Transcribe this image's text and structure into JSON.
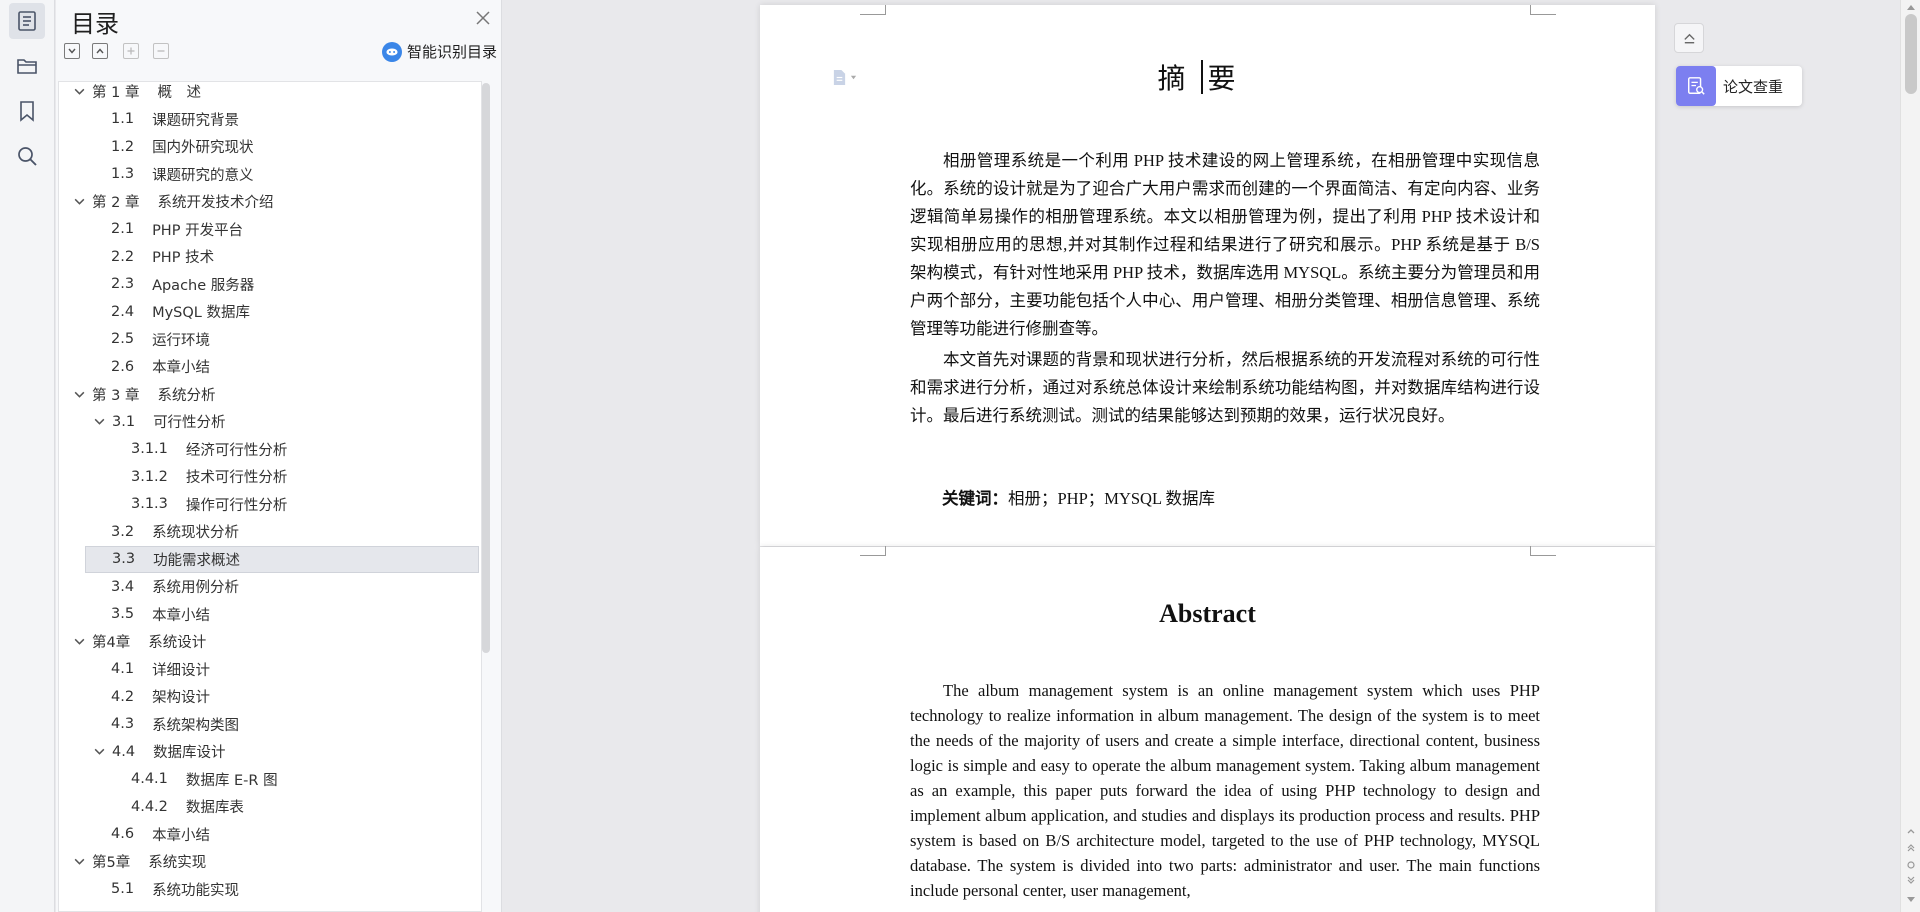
{
  "rail": {
    "items": [
      {
        "name": "outline-icon"
      },
      {
        "name": "folder-icon"
      },
      {
        "name": "bookmark-icon"
      },
      {
        "name": "search-icon"
      }
    ]
  },
  "toc": {
    "title": "目录",
    "smart_label": "智能识别目录",
    "items": [
      {
        "num": "第 1 章",
        "text": "概　述",
        "level": 0,
        "caret": true
      },
      {
        "num": "1.1",
        "text": "课题研究背景",
        "level": 1
      },
      {
        "num": "1.2",
        "text": "国内外研究现状",
        "level": 1
      },
      {
        "num": "1.3",
        "text": "课题研究的意义",
        "level": 1
      },
      {
        "num": "第 2 章",
        "text": "系统开发技术介绍",
        "level": 0,
        "caret": true
      },
      {
        "num": "2.1",
        "text": "PHP 开发平台",
        "level": 1
      },
      {
        "num": "2.2",
        "text": "PHP 技术",
        "level": 1
      },
      {
        "num": "2.3",
        "text": "Apache 服务器",
        "level": 1
      },
      {
        "num": "2.4",
        "text": "MySQL 数据库",
        "level": 1
      },
      {
        "num": "2.5",
        "text": "运行环境",
        "level": 1
      },
      {
        "num": "2.6",
        "text": "本章小结",
        "level": 1
      },
      {
        "num": "第 3 章",
        "text": "系统分析",
        "level": 0,
        "caret": true
      },
      {
        "num": "3.1",
        "text": "可行性分析",
        "level": 1,
        "caret": true
      },
      {
        "num": "3.1.1",
        "text": "经济可行性分析",
        "level": 2
      },
      {
        "num": "3.1.2",
        "text": "技术可行性分析",
        "level": 2
      },
      {
        "num": "3.1.3",
        "text": "操作可行性分析",
        "level": 2
      },
      {
        "num": "3.2",
        "text": "系统现状分析",
        "level": 1
      },
      {
        "num": "3.3",
        "text": "功能需求概述",
        "level": 1,
        "selected": true
      },
      {
        "num": "3.4",
        "text": "系统用例分析",
        "level": 1
      },
      {
        "num": "3.5",
        "text": "本章小结",
        "level": 1
      },
      {
        "num": "第4章",
        "text": "系统设计",
        "level": 0,
        "caret": true
      },
      {
        "num": "4.1",
        "text": "详细设计",
        "level": 1
      },
      {
        "num": "4.2",
        "text": "架构设计",
        "level": 1
      },
      {
        "num": "4.3",
        "text": "系统架构类图",
        "level": 1
      },
      {
        "num": "4.4",
        "text": "数据库设计",
        "level": 1,
        "caret": true
      },
      {
        "num": "4.4.1",
        "text": "数据库 E-R 图",
        "level": 2
      },
      {
        "num": "4.4.2",
        "text": "数据库表",
        "level": 2
      },
      {
        "num": "4.6",
        "text": "本章小结",
        "level": 1
      },
      {
        "num": "第5章",
        "text": "系统实现",
        "level": 0,
        "caret": true
      },
      {
        "num": "5.1",
        "text": "系统功能实现",
        "level": 1
      }
    ]
  },
  "doc": {
    "abstract_zh_title": "摘要",
    "abstract_zh_p1": "相册管理系统是一个利用 PHP 技术建设的网上管理系统，在相册管理中实现信息化。系统的设计就是为了迎合广大用户需求而创建的一个界面简洁、有定向内容、业务逻辑简单易操作的相册管理系统。本文以相册管理为例，提出了利用 PHP 技术设计和实现相册应用的思想,并对其制作过程和结果进行了研究和展示。PHP 系统是基于 B/S 架构模式，有针对性地采用 PHP 技术，数据库选用 MYSQL。系统主要分为管理员和用户两个部分，主要功能包括个人中心、用户管理、相册分类管理、相册信息管理、系统管理等功能进行修删查等。",
    "abstract_zh_p2": "本文首先对课题的背景和现状进行分析，然后根据系统的开发流程对系统的可行性和需求进行分析，通过对系统总体设计来绘制系统功能结构图，并对数据库结构进行设计。最后进行系统测试。测试的结果能够达到预期的效果，运行状况良好。",
    "keywords_label": "关键词：",
    "keywords_value": "相册；PHP；MYSQL 数据库",
    "abstract_en_title": "Abstract",
    "abstract_en_p1": "The album management system is an online management system which uses PHP technology to realize information in album management. The design of the system is to meet the needs of the majority of users and create a simple interface, directional content, business logic is simple and easy to operate the album management system. Taking album management as an example, this paper puts forward the idea of using PHP technology to design and implement album application, and studies and displays its production process and results. PHP system is based on B/S architecture model, targeted to the use of PHP technology, MYSQL database. The system is divided into two parts: administrator and user. The main functions include personal center, user management,"
  },
  "tools": {
    "plagiarism_label": "论文查重"
  }
}
